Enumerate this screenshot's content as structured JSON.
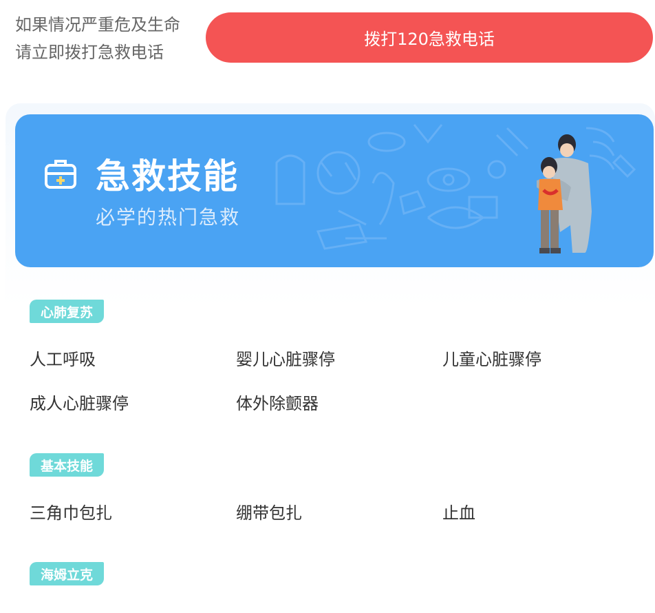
{
  "warning": {
    "line1": "如果情况严重危及生命",
    "line2": "请立即拨打急救电话"
  },
  "call_button": {
    "label": "拨打120急救电话"
  },
  "banner": {
    "title": "急救技能",
    "subtitle": "必学的热门急救",
    "icon": "first-aid-kit-icon"
  },
  "sections": [
    {
      "tag": "心肺复苏",
      "items": [
        "人工呼吸",
        "婴儿心脏骤停",
        "儿童心脏骤停",
        "成人心脏骤停",
        "体外除颤器"
      ]
    },
    {
      "tag": "基本技能",
      "items": [
        "三角巾包扎",
        "绷带包扎",
        "止血"
      ]
    },
    {
      "tag": "海姆立克",
      "items": []
    }
  ],
  "colors": {
    "call_button": "#f45454",
    "banner": "#4aa3f3",
    "tag": "#6fd9d9"
  }
}
